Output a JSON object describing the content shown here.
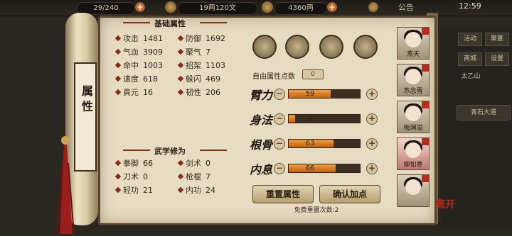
{
  "topbar": {
    "stamina": "29/240",
    "silver": "19两120文",
    "gold": "4360两",
    "notice": "公告",
    "time": "12:59"
  },
  "side_menu": [
    "活动",
    "聚宴",
    "商城",
    "设置",
    "太乙山"
  ],
  "quest": "青石大道",
  "scroll_title": "属 性",
  "basic_title": "基础属性",
  "basic_stats": [
    {
      "label": "攻击",
      "value": "1481"
    },
    {
      "label": "防御",
      "value": "1692"
    },
    {
      "label": "气血",
      "value": "3909"
    },
    {
      "label": "聚气",
      "value": "7"
    },
    {
      "label": "命中",
      "value": "1003"
    },
    {
      "label": "招架",
      "value": "1103"
    },
    {
      "label": "速度",
      "value": "618"
    },
    {
      "label": "躲闪",
      "value": "469"
    },
    {
      "label": "真元",
      "value": "16"
    },
    {
      "label": "韧性",
      "value": "206"
    }
  ],
  "martial_title": "武学修为",
  "martial_stats": [
    {
      "label": "拳脚",
      "value": "66"
    },
    {
      "label": "剑术",
      "value": "0"
    },
    {
      "label": "刀术",
      "value": "0"
    },
    {
      "label": "枪棍",
      "value": "7"
    },
    {
      "label": "轻功",
      "value": "21"
    },
    {
      "label": "内功",
      "value": "24"
    }
  ],
  "free_points_label": "自由属性点数",
  "free_points": "0",
  "attributes": [
    {
      "label": "臂力",
      "value": "59",
      "fill": 0.59
    },
    {
      "label": "身法",
      "value": "9",
      "fill": 0.09
    },
    {
      "label": "根骨",
      "value": "63",
      "fill": 0.63
    },
    {
      "label": "内息",
      "value": "66",
      "fill": 0.66
    }
  ],
  "reset_button": "重置属性",
  "confirm_button": "确认加点",
  "free_reset_text": "免费重置次数:2",
  "characters": [
    {
      "name": "燕天",
      "selected": false
    },
    {
      "name": "苏念雪",
      "selected": false
    },
    {
      "name": "梅渊溢",
      "selected": false
    },
    {
      "name": "柳如意",
      "selected": true
    },
    {
      "name": "",
      "selected": false
    }
  ],
  "leave_label": "离开",
  "colors": {
    "accent": "#8a2a1a",
    "bar": "#e08a30",
    "parchment": "#e6dcc2"
  }
}
